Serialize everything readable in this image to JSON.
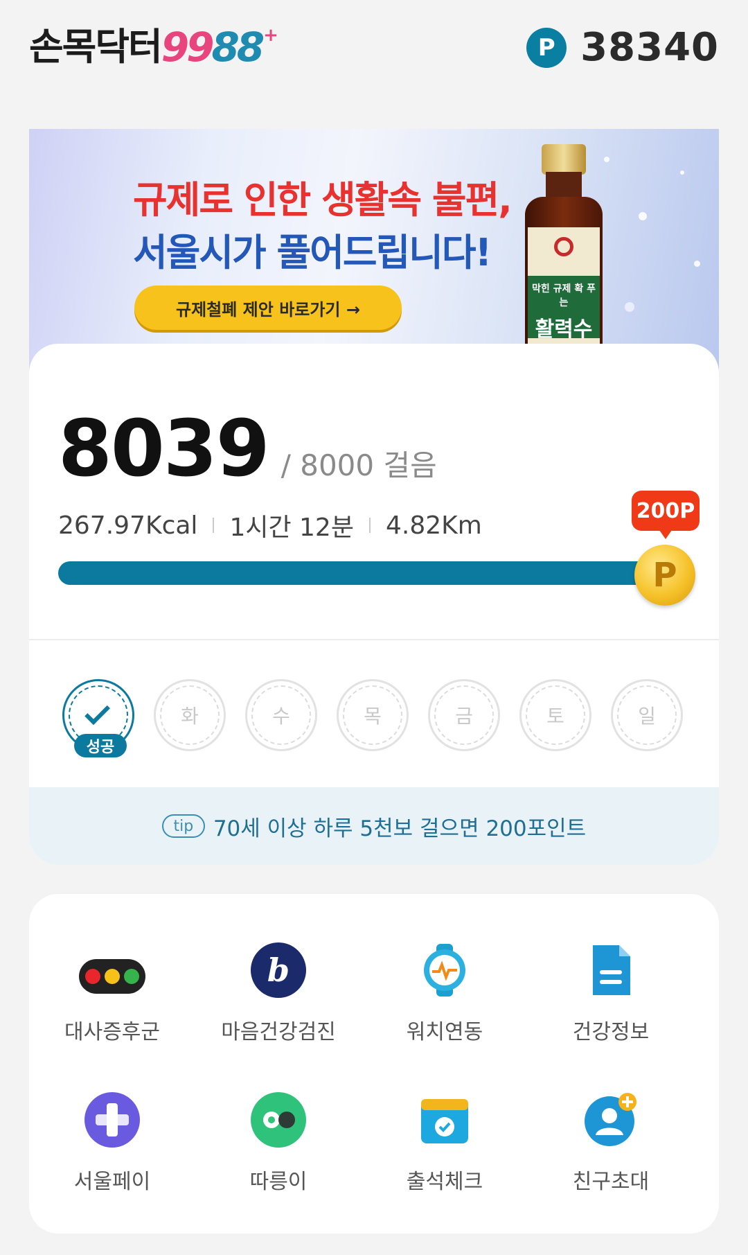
{
  "header": {
    "logo_korean": "손목닥터",
    "logo_num1": "99",
    "logo_num2": "88",
    "logo_plus": "+",
    "points_icon_label": "P",
    "points_value": "38340"
  },
  "banner": {
    "line1": "규제로 인한 생활속 불편,",
    "line2": "서울시가 풀어드립니다!",
    "cta": "규제철폐 제안 바로가기 →",
    "bottle_band_top": "막힌 규제 확 푸는",
    "bottle_band_main": "활력수"
  },
  "steps": {
    "count": "8039",
    "goal_text": "/ 8000 걸음",
    "progress_fraction": 1.0,
    "kcal": "267.97Kcal",
    "duration": "1시간 12분",
    "distance": "4.82Km",
    "reward_bubble": "200P",
    "coin_label": "P"
  },
  "week": {
    "done_badge": "성공",
    "days": [
      "화",
      "수",
      "목",
      "금",
      "토",
      "일"
    ]
  },
  "tip": {
    "pill": "tip",
    "text": "70세 이상 하루 5천보 걸으면 200포인트"
  },
  "menu": {
    "items": [
      {
        "label": "대사증후군",
        "icon": "traffic-light-icon"
      },
      {
        "label": "마음건강검진",
        "icon": "mind-check-icon"
      },
      {
        "label": "워치연동",
        "icon": "watch-icon"
      },
      {
        "label": "건강정보",
        "icon": "document-icon"
      },
      {
        "label": "서울페이",
        "icon": "seoulpay-icon"
      },
      {
        "label": "따릉이",
        "icon": "bike-icon"
      },
      {
        "label": "출석체크",
        "icon": "calendar-check-icon"
      },
      {
        "label": "친구초대",
        "icon": "invite-friend-icon"
      }
    ]
  },
  "colors": {
    "primary": "#0b7a9e",
    "accent_red": "#f03a17",
    "background": "#f3f3f3"
  }
}
